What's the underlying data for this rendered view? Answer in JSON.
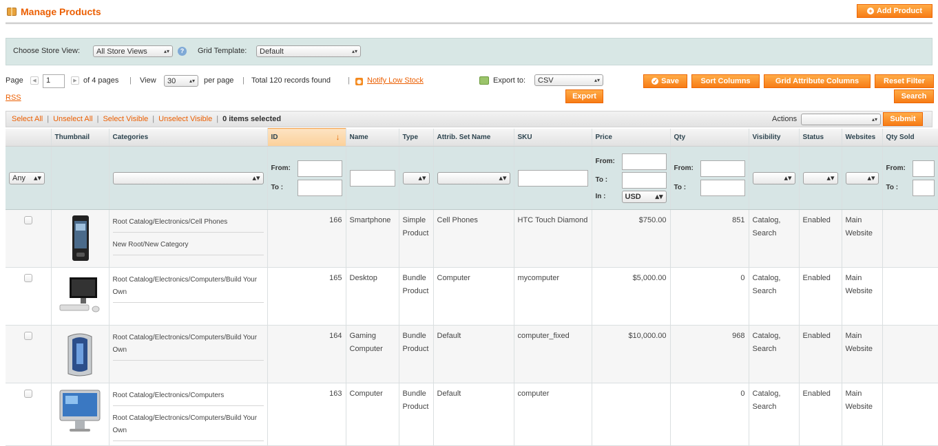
{
  "header": {
    "title": "Manage Products",
    "add_product": "Add Product"
  },
  "store_bar": {
    "store_label": "Choose Store View:",
    "store_value": "All Store Views",
    "template_label": "Grid Template:",
    "template_value": "Default"
  },
  "pager": {
    "page_label": "Page",
    "page_value": "1",
    "of_pages": "of 4 pages",
    "view_label": "View",
    "per_page_value": "30",
    "per_page_label": "per page",
    "records": "Total 120 records found",
    "notify": "Notify Low Stock",
    "rss": "RSS",
    "export_label": "Export to:",
    "export_value": "CSV",
    "export_btn": "Export"
  },
  "buttons": {
    "save": "Save",
    "sort_columns": "Sort Columns",
    "grid_attr": "Grid Attribute Columns",
    "reset_filter": "Reset Filter",
    "search": "Search",
    "submit": "Submit"
  },
  "massaction": {
    "select_all": "Select All",
    "unselect_all": "Unselect All",
    "select_visible": "Select Visible",
    "unselect_visible": "Unselect Visible",
    "selected": "0 items selected",
    "actions_label": "Actions"
  },
  "columns": [
    "",
    "Thumbnail",
    "Categories",
    "ID",
    "Name",
    "Type",
    "Attrib. Set Name",
    "SKU",
    "Price",
    "Qty",
    "Visibility",
    "Status",
    "Websites",
    "Qty Sold"
  ],
  "filters": {
    "any": "Any",
    "from": "From:",
    "to": "To :",
    "in": "In :",
    "currency": "USD"
  },
  "rows": [
    {
      "categories": [
        "Root Catalog/Electronics/Cell Phones",
        "New Root/New Category"
      ],
      "id": "166",
      "name": "Smartphone",
      "type": "Simple Product",
      "attrib": "Cell Phones",
      "sku": "HTC Touch Diamond",
      "price": "$750.00",
      "qty": "851",
      "visibility": "Catalog, Search",
      "status": "Enabled",
      "websites": "Main Website",
      "thumb": "phone"
    },
    {
      "categories": [
        "Root Catalog/Electronics/Computers/Build Your Own"
      ],
      "id": "165",
      "name": "Desktop",
      "type": "Bundle Product",
      "attrib": "Computer",
      "sku": "mycomputer",
      "price": "$5,000.00",
      "qty": "0",
      "visibility": "Catalog, Search",
      "status": "Enabled",
      "websites": "Main Website",
      "thumb": "desktop"
    },
    {
      "categories": [
        "Root Catalog/Electronics/Computers/Build Your Own"
      ],
      "id": "164",
      "name": "Gaming Computer",
      "type": "Bundle Product",
      "attrib": "Default",
      "sku": "computer_fixed",
      "price": "$10,000.00",
      "qty": "968",
      "visibility": "Catalog, Search",
      "status": "Enabled",
      "websites": "Main Website",
      "thumb": "tower"
    },
    {
      "categories": [
        "Root Catalog/Electronics/Computers",
        "Root Catalog/Electronics/Computers/Build Your Own"
      ],
      "id": "163",
      "name": "Computer",
      "type": "Bundle Product",
      "attrib": "Default",
      "sku": "computer",
      "price": "",
      "qty": "0",
      "visibility": "Catalog, Search",
      "status": "Enabled",
      "websites": "Main Website",
      "thumb": "imac"
    }
  ]
}
